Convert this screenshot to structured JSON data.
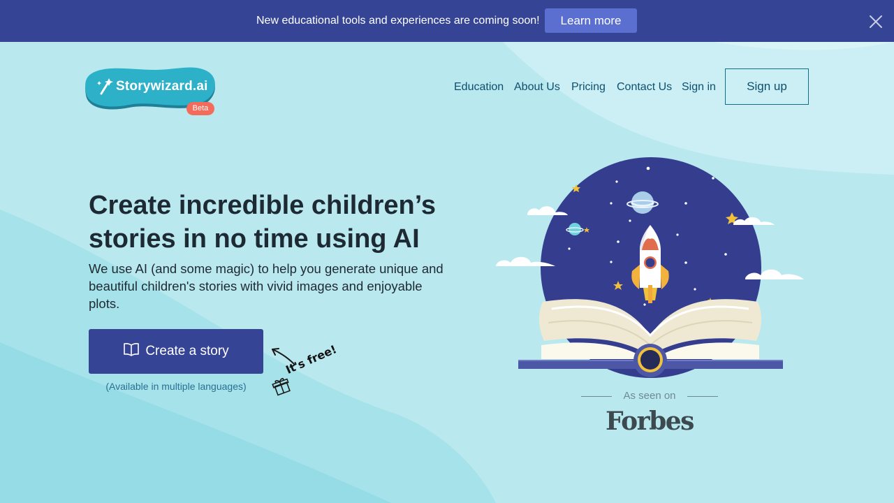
{
  "banner": {
    "message": "New educational tools and experiences are coming soon!",
    "button_label": "Learn more",
    "close_icon": "close-icon"
  },
  "header": {
    "logo_text": "Storywizard.ai",
    "beta_label": "Beta",
    "nav": {
      "education": "Education",
      "about": "About Us",
      "pricing": "Pricing",
      "contact": "Contact Us",
      "signin": "Sign in"
    },
    "signup_label": "Sign up"
  },
  "hero": {
    "title": "Create incredible children’s stories in no time using AI",
    "subtitle": "We use AI (and some magic) to help you generate unique and beautiful children's stories with vivid images and enjoyable plots.",
    "cta_label": "Create a story",
    "cta_icon": "open-book-icon",
    "cta_note": "(Available in multiple languages)",
    "free_label": "It's free!"
  },
  "press": {
    "label": "As seen on",
    "logo": "Forbes"
  },
  "colors": {
    "banner_bg": "#354495",
    "banner_button": "#5a6fcf",
    "primary": "#354495",
    "background": "#b9e8ee",
    "logo_blob": "#2cb1c9",
    "beta_badge": "#f26b5b",
    "nav_text": "#0f4f6e"
  }
}
